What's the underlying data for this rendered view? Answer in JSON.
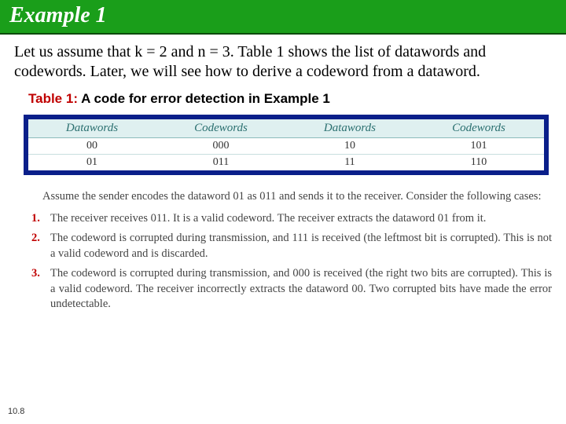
{
  "title": "Example 1",
  "intro": "Let us assume that k = 2 and n = 3. Table 1 shows the list of datawords and codewords. Later, we will see how to derive a codeword from a dataword.",
  "table": {
    "label": "Table 1",
    "caption": "A code for error detection in Example 1",
    "headers": [
      "Datawords",
      "Codewords",
      "Datawords",
      "Codewords"
    ],
    "rows": [
      [
        "00",
        "000",
        "10",
        "101"
      ],
      [
        "01",
        "011",
        "11",
        "110"
      ]
    ]
  },
  "cases": {
    "lead": "Assume the sender encodes the dataword 01 as 011 and sends it to the receiver. Consider the following cases:",
    "items": [
      {
        "num": "1.",
        "text": "The receiver receives 011. It is a valid codeword. The receiver extracts the dataword 01 from it."
      },
      {
        "num": "2.",
        "text": "The codeword is corrupted during transmission, and 111 is received (the leftmost bit is corrupted). This is not a valid codeword and is discarded."
      },
      {
        "num": "3.",
        "text": "The codeword is corrupted during transmission, and 000 is received (the right two bits are corrupted). This is a valid codeword. The receiver incorrectly extracts the dataword 00. Two corrupted bits have made the error undetectable."
      }
    ]
  },
  "page_number": "10.8"
}
